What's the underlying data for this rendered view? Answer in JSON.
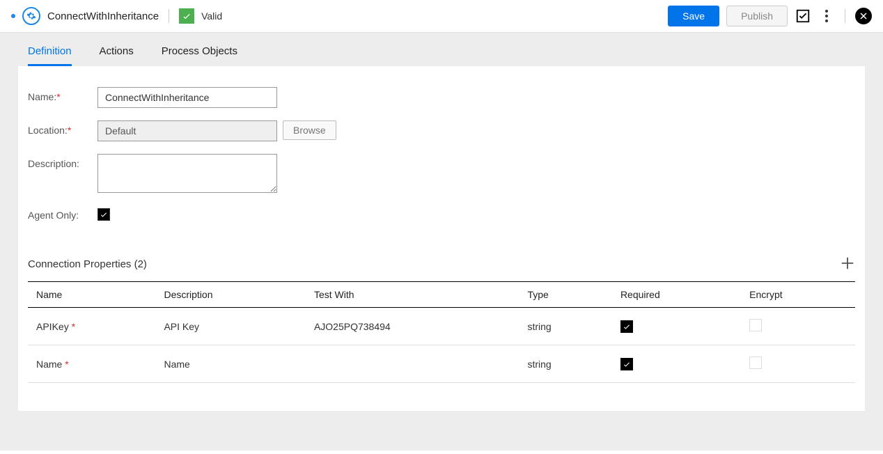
{
  "header": {
    "title": "ConnectWithInheritance",
    "status": "Valid",
    "save_label": "Save",
    "publish_label": "Publish"
  },
  "tabs": [
    {
      "label": "Definition",
      "active": true
    },
    {
      "label": "Actions",
      "active": false
    },
    {
      "label": "Process Objects",
      "active": false
    }
  ],
  "form": {
    "name_label": "Name:",
    "name_value": "ConnectWithInheritance",
    "location_label": "Location:",
    "location_value": "Default",
    "browse_label": "Browse",
    "description_label": "Description:",
    "description_value": "",
    "agent_only_label": "Agent Only:",
    "agent_only_checked": true
  },
  "section": {
    "title": "Connection Properties (2)"
  },
  "table": {
    "headers": {
      "name": "Name",
      "description": "Description",
      "test_with": "Test With",
      "type": "Type",
      "required": "Required",
      "encrypt": "Encrypt"
    },
    "rows": [
      {
        "name": "APIKey",
        "required_mark": true,
        "description": "API Key",
        "test_with": "AJO25PQ738494",
        "type": "string",
        "required": true,
        "encrypt": false
      },
      {
        "name": "Name",
        "required_mark": true,
        "description": "Name",
        "test_with": "",
        "type": "string",
        "required": true,
        "encrypt": false
      }
    ]
  }
}
